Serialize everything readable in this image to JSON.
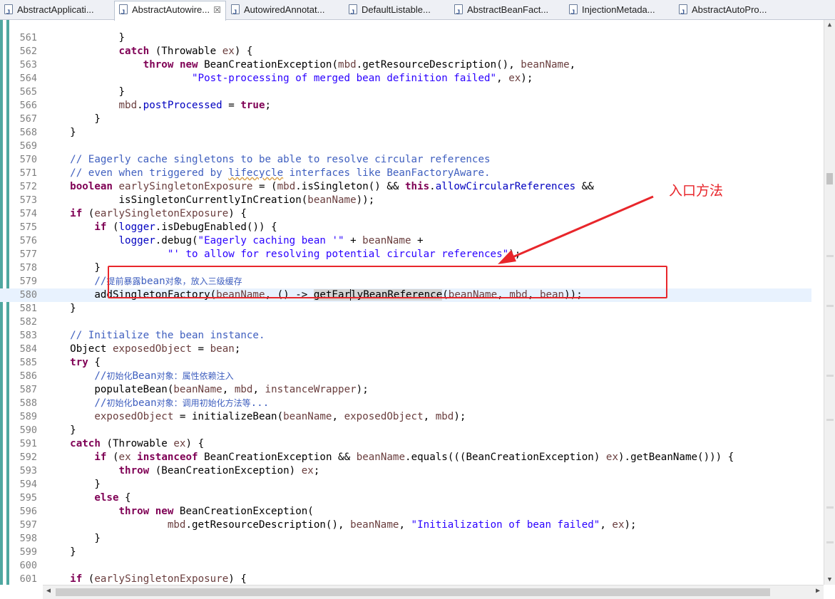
{
  "tabs": [
    {
      "label": "AbstractApplicati...",
      "active": false
    },
    {
      "label": "AbstractAutowire...",
      "active": true,
      "close": "☒"
    },
    {
      "label": "AutowiredAnnotat...",
      "active": false
    },
    {
      "label": "DefaultListable...",
      "active": false
    },
    {
      "label": "AbstractBeanFact...",
      "active": false
    },
    {
      "label": "InjectionMetada...",
      "active": false
    },
    {
      "label": "AbstractAutoPro...",
      "active": false
    }
  ],
  "annotation": {
    "text": "入口方法",
    "color": "#e8262b"
  },
  "editor": {
    "current_line": 580,
    "keyword_color": "#7f0055",
    "comment_color": "#3f5fbf",
    "string_color": "#2a00ff"
  },
  "code_lines": [
    {
      "n": 561,
      "html": "            }"
    },
    {
      "n": 562,
      "html": "            <span class=\"kw\">catch</span> (Throwable <span class=\"var\">ex</span>) {"
    },
    {
      "n": 563,
      "html": "                <span class=\"kw\">throw</span> <span class=\"kw\">new</span> BeanCreationException(<span class=\"var\">mbd</span>.getResourceDescription(), <span class=\"var\">beanName</span>,"
    },
    {
      "n": 564,
      "html": "                        <span class=\"str\">\"Post-processing of merged bean definition failed\"</span>, <span class=\"var\">ex</span>);"
    },
    {
      "n": 565,
      "html": "            }"
    },
    {
      "n": 566,
      "html": "            <span class=\"var\">mbd</span>.<span class=\"fld\">postProcessed</span> = <span class=\"kw\">true</span>;"
    },
    {
      "n": 567,
      "html": "        }"
    },
    {
      "n": 568,
      "html": "    }"
    },
    {
      "n": 569,
      "html": ""
    },
    {
      "n": 570,
      "html": "    <span class=\"cm\">// Eagerly cache singletons to be able to resolve circular references</span>"
    },
    {
      "n": 571,
      "html": "    <span class=\"cm\">// even when triggered by <span class=\"squig\">lifecycle</span> interfaces like BeanFactoryAware.</span>"
    },
    {
      "n": 572,
      "html": "    <span class=\"kw\">boolean</span> <span class=\"var\">earlySingletonExposure</span> = (<span class=\"var\">mbd</span>.isSingleton() &amp;&amp; <span class=\"kw\">this</span>.<span class=\"fld\">allowCircularReferences</span> &amp;&amp;"
    },
    {
      "n": 573,
      "html": "            isSingletonCurrentlyInCreation(<span class=\"var\">beanName</span>));"
    },
    {
      "n": 574,
      "html": "    <span class=\"kw\">if</span> (<span class=\"var\">earlySingletonExposure</span>) {"
    },
    {
      "n": 575,
      "html": "        <span class=\"kw\">if</span> (<span class=\"fld\">logger</span>.isDebugEnabled()) {"
    },
    {
      "n": 576,
      "html": "            <span class=\"fld\">logger</span>.debug(<span class=\"str\">\"Eagerly caching bean '\"</span> + <span class=\"var\">beanName</span> +"
    },
    {
      "n": 577,
      "html": "                    <span class=\"str\">\"' to allow for resolving potential circular references\"</span>);"
    },
    {
      "n": 578,
      "html": "        }"
    },
    {
      "n": 579,
      "html": "        <span class=\"cm\">//<span class=\"cn\">提前暴露</span>bean<span class=\"cn\">对象，放入三级缓存</span></span>"
    },
    {
      "n": 580,
      "html": "        addSingletonFactory(<span class=\"var\">beanName</span>, () -&gt; <span class=\"hl\">getEar<span class=\"caret\"></span>lyBeanReference</span>(<span class=\"var\">beanName</span>, <span class=\"var\">mbd</span>, <span class=\"var\">bean</span>));"
    },
    {
      "n": 581,
      "html": "    }"
    },
    {
      "n": 582,
      "html": ""
    },
    {
      "n": 583,
      "html": "    <span class=\"cm\">// Initialize the bean instance.</span>"
    },
    {
      "n": 584,
      "html": "    Object <span class=\"var\">exposedObject</span> = <span class=\"var\">bean</span>;"
    },
    {
      "n": 585,
      "html": "    <span class=\"kw\">try</span> {"
    },
    {
      "n": 586,
      "html": "        <span class=\"cm\">//<span class=\"cn\">初始化</span>Bean<span class=\"cn\">对象：属性依赖注入</span></span>"
    },
    {
      "n": 587,
      "html": "        populateBean(<span class=\"var\">beanName</span>, <span class=\"var\">mbd</span>, <span class=\"var\">instanceWrapper</span>);"
    },
    {
      "n": 588,
      "html": "        <span class=\"cm\">//<span class=\"cn\">初始化</span>bean<span class=\"cn\">对象：调用初始化方法等</span>...</span>"
    },
    {
      "n": 589,
      "html": "        <span class=\"var\">exposedObject</span> = initializeBean(<span class=\"var\">beanName</span>, <span class=\"var\">exposedObject</span>, <span class=\"var\">mbd</span>);"
    },
    {
      "n": 590,
      "html": "    }"
    },
    {
      "n": 591,
      "html": "    <span class=\"kw\">catch</span> (Throwable <span class=\"var\">ex</span>) {"
    },
    {
      "n": 592,
      "html": "        <span class=\"kw\">if</span> (<span class=\"var\">ex</span> <span class=\"kw\">instanceof</span> BeanCreationException &amp;&amp; <span class=\"var\">beanName</span>.equals(((BeanCreationException) <span class=\"var\">ex</span>).getBeanName())) {"
    },
    {
      "n": 593,
      "html": "            <span class=\"kw\">throw</span> (BeanCreationException) <span class=\"var\">ex</span>;"
    },
    {
      "n": 594,
      "html": "        }"
    },
    {
      "n": 595,
      "html": "        <span class=\"kw\">else</span> {"
    },
    {
      "n": 596,
      "html": "            <span class=\"kw\">throw</span> <span class=\"kw\">new</span> BeanCreationException("
    },
    {
      "n": 597,
      "html": "                    <span class=\"var\">mbd</span>.getResourceDescription(), <span class=\"var\">beanName</span>, <span class=\"str\">\"Initialization of bean failed\"</span>, <span class=\"var\">ex</span>);"
    },
    {
      "n": 598,
      "html": "        }"
    },
    {
      "n": 599,
      "html": "    }"
    },
    {
      "n": 600,
      "html": ""
    },
    {
      "n": 601,
      "html": "    <span class=\"kw\">if</span> (<span class=\"var\">earlySingletonExposure</span>) {"
    }
  ],
  "scrollbars": {
    "up": "▲",
    "down": "▼",
    "left": "◀",
    "right": "▶"
  }
}
